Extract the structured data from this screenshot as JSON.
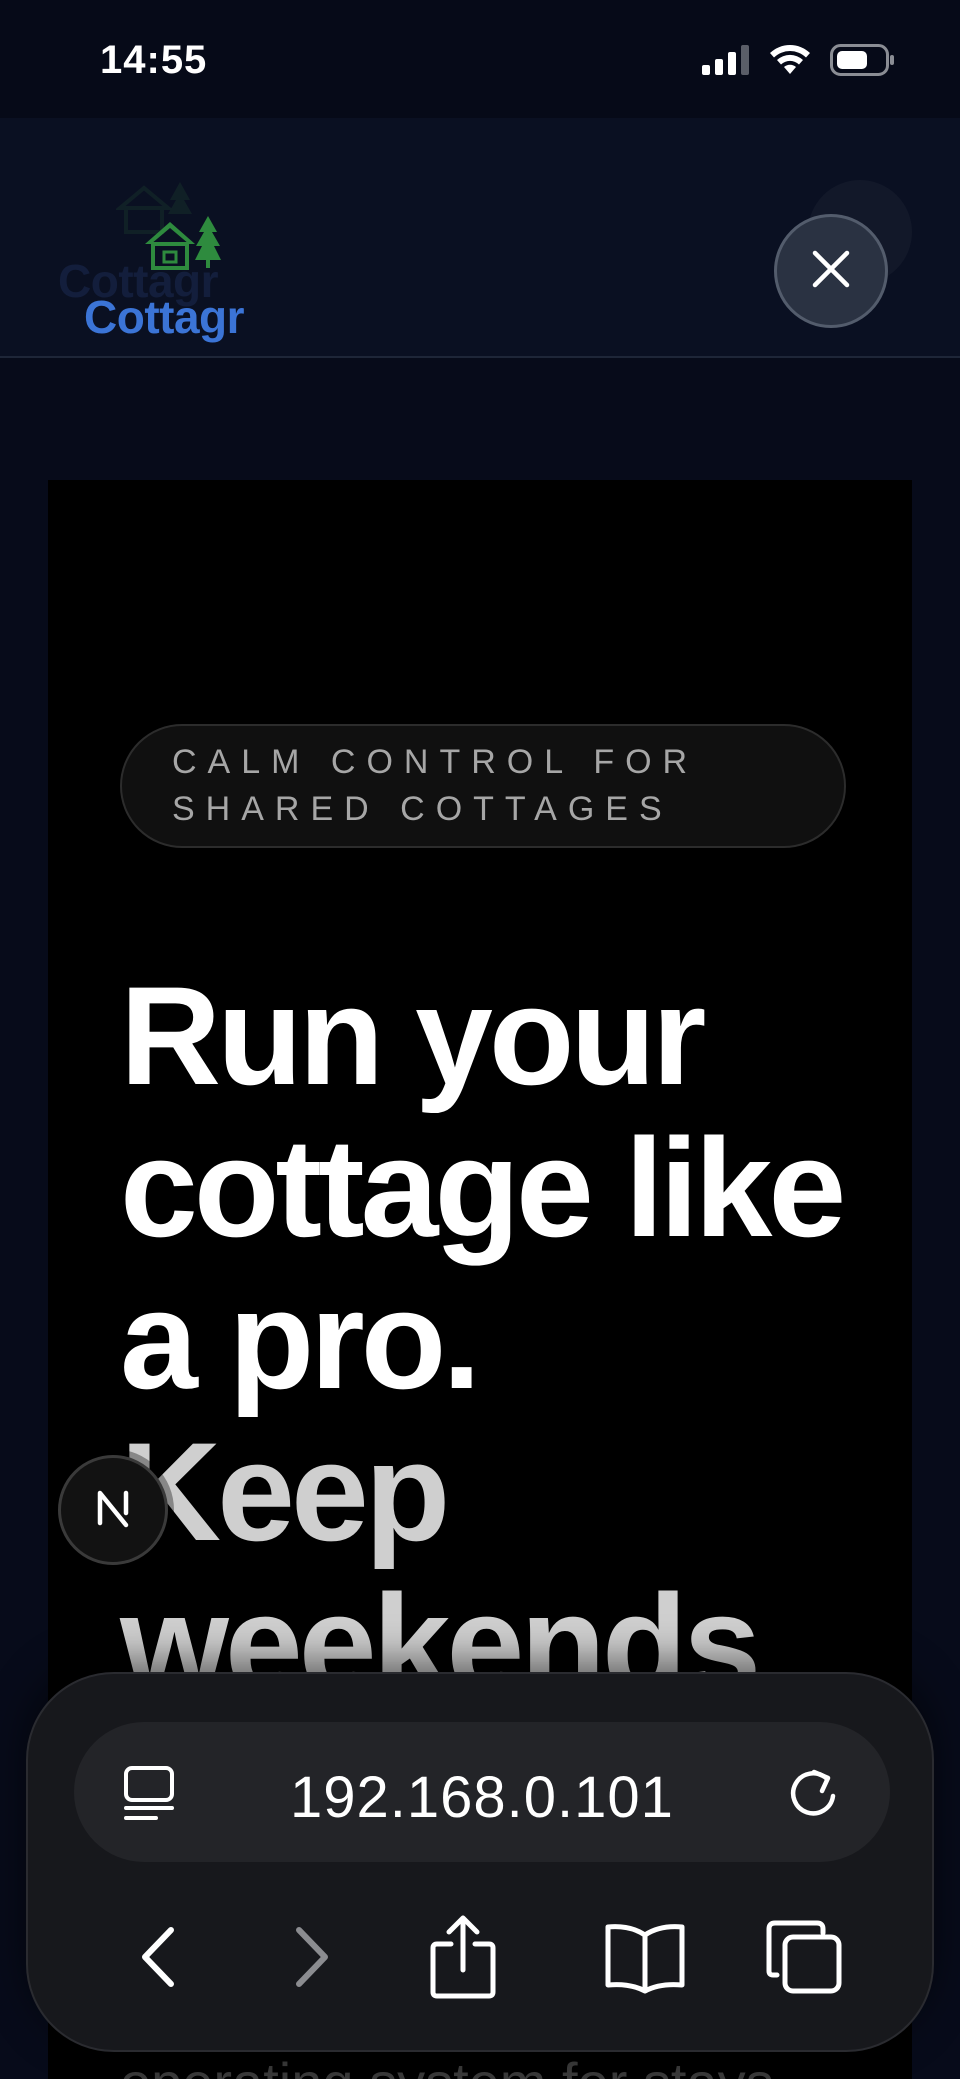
{
  "status_bar": {
    "time": "14:55",
    "icons": [
      "cellular-signal-icon",
      "wifi-icon",
      "battery-icon"
    ]
  },
  "site_header": {
    "logo_text": "Cottagr",
    "close_icon": "close-icon"
  },
  "hero": {
    "eyebrow": "CALM CONTROL FOR SHARED COTTAGES",
    "headline_line1": "Run your cottage like a pro.",
    "headline_line2": "Keep weekends",
    "subtext": "operating system for stays"
  },
  "browser": {
    "address": "192.168.0.101",
    "buttons": [
      "back-icon",
      "forward-icon",
      "share-icon",
      "bookmarks-icon",
      "tabs-icon"
    ]
  },
  "colors": {
    "brand_blue": "#3b74d6",
    "brand_green": "#2e8b3e",
    "hero_bg": "#000000",
    "page_bg": "#070b1a"
  }
}
